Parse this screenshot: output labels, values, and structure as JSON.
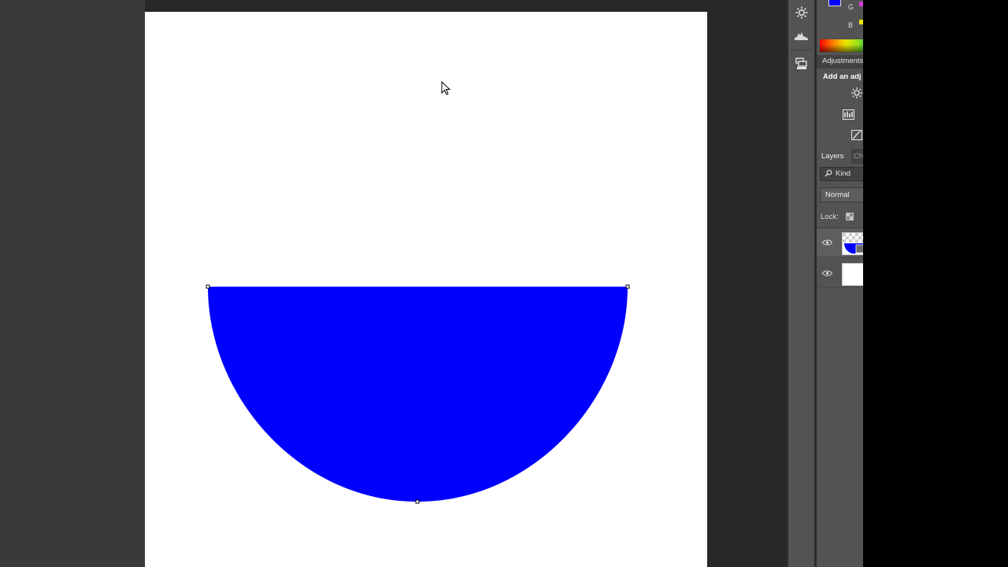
{
  "colors": {
    "shape_fill": "#0000ff",
    "canvas_bg": "#ffffff",
    "workspace_bg": "#282828",
    "panel_bg": "#535353",
    "panel_tab_bg": "#424242"
  },
  "right_toolstrip": {
    "icons": [
      "adjust-sun-icon",
      "histogram-icon",
      "layer-comps-icon"
    ]
  },
  "color_panel": {
    "channel_g": "G",
    "channel_b": "B"
  },
  "adjustments_panel": {
    "tab_label": "Adjustments",
    "add_text": "Add an adj",
    "icons": [
      "brightness-icon",
      "levels-icon",
      "curves-icon"
    ]
  },
  "layers_panel": {
    "tab_label": "Layers",
    "channels_tab_label": "Ch",
    "filter_label": "Kind",
    "blend_mode": "Normal",
    "lock_label": "Lock:",
    "layers": [
      {
        "kind": "shape-layer",
        "visible": true,
        "selected": true
      },
      {
        "kind": "background-layer",
        "visible": true,
        "selected": false
      }
    ]
  }
}
